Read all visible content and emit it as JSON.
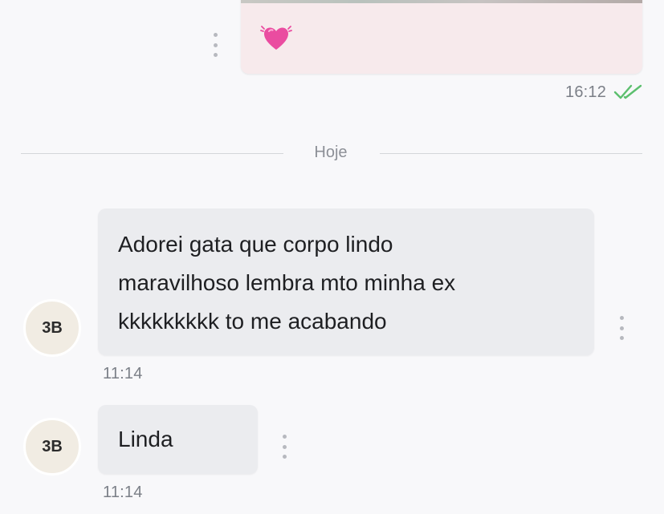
{
  "outgoing": {
    "emoji_icon": "beating-heart-icon",
    "time": "16:12",
    "status_icon": "double-check-icon",
    "status_color": "#5cbf6e",
    "bubble_color": "#f7eaec"
  },
  "divider": {
    "label": "Hoje"
  },
  "incoming": [
    {
      "avatar_initials": "3B",
      "lines": [
        "Adorei gata que corpo lindo",
        "maravilhoso lembra mto minha ex",
        "kkkkkkkkk to me acabando"
      ],
      "time": "11:14"
    },
    {
      "avatar_initials": "3B",
      "lines": [
        "Linda"
      ],
      "time": "11:14"
    }
  ],
  "colors": {
    "background": "#f8f8fa",
    "incoming_bubble": "#ebecef",
    "avatar_bg": "#f1ece3"
  }
}
